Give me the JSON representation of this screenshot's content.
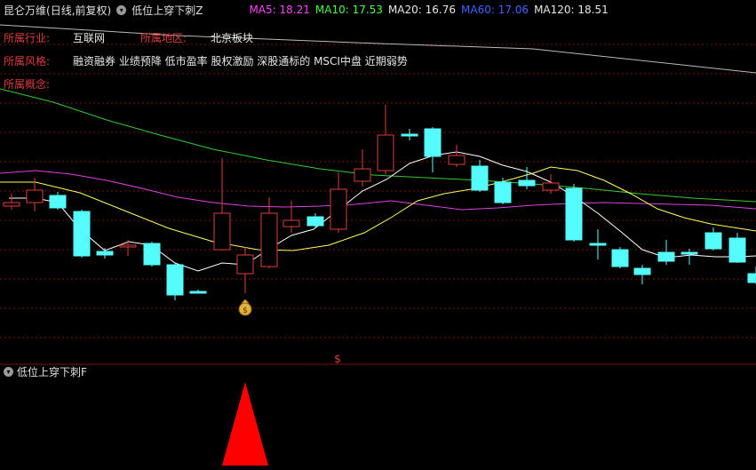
{
  "header": {
    "stock_name": "昆仑万维",
    "period": "(日线,前复权)",
    "indicator_name": "低位上穿下刺Z",
    "ma": [
      {
        "label": "MA5:",
        "value": "18.21",
        "color": "#ff44ff"
      },
      {
        "label": "MA10:",
        "value": "17.53",
        "color": "#44ff44"
      },
      {
        "label": "MA20:",
        "value": "16.76",
        "color": "#e8e8e8"
      },
      {
        "label": "MA60:",
        "value": "17.06",
        "color": "#3c64ff"
      },
      {
        "label": "MA120:",
        "value": "18.51",
        "color": "#e8e8e8"
      }
    ]
  },
  "info": {
    "industry_label": "所属行业:",
    "industry_value": "互联网",
    "region_label": "所属地区:",
    "region_value": "北京板块",
    "style_label": "所属风格:",
    "style_value": "融资融券 业绩预降 低市盈率 股权激励 深股通标的 MSCI中盘 近期弱势",
    "concept_label": "所属概念:"
  },
  "indicator_panel": {
    "title": "低位上穿下刺F",
    "signal_value": 1
  },
  "markers": {
    "money_bag_icon": "money-bag-icon",
    "dollar_symbol": "$"
  },
  "colors": {
    "up": "#e03c3c",
    "down": "#54fcfc",
    "grid": "#7a0f0f",
    "ma5_line": "#ffffff",
    "ma10_line": "#ffff55",
    "ma20_line": "#e040e0",
    "ma60_line": "#33cc33",
    "ma120_line": "#bbbbbb",
    "signal": "#ff0000"
  }
}
